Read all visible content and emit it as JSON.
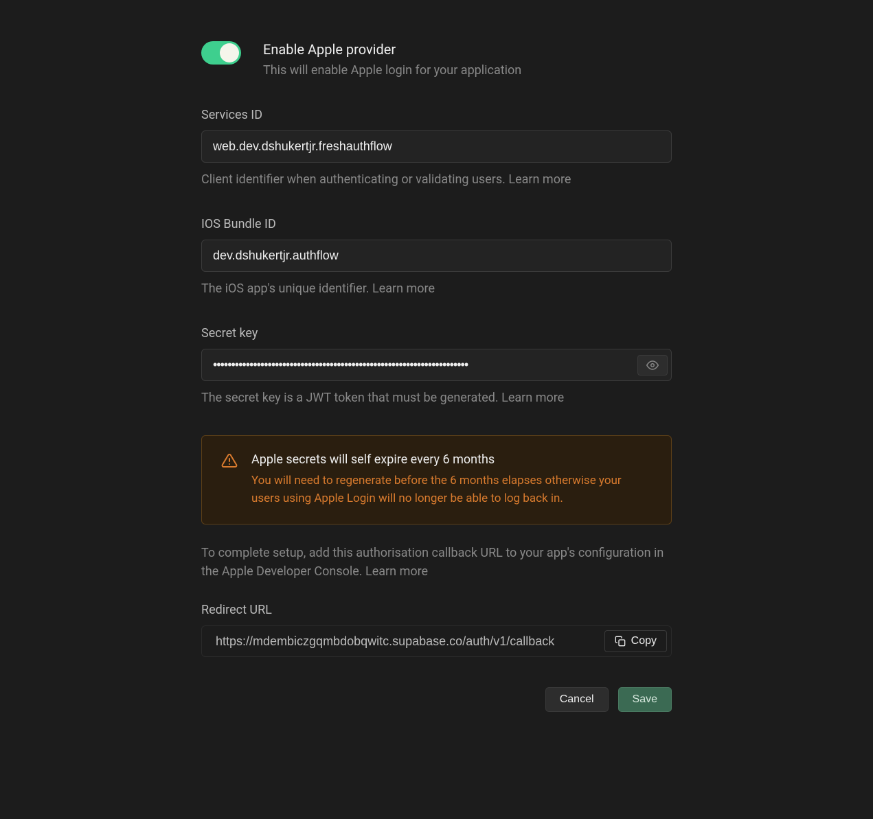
{
  "toggle": {
    "title": "Enable Apple provider",
    "subtitle": "This will enable Apple login for your application"
  },
  "servicesId": {
    "label": "Services ID",
    "value": "web.dev.dshukertjr.freshauthflow",
    "help": "Client identifier when authenticating or validating users. ",
    "learnMore": "Learn more"
  },
  "iosBundleId": {
    "label": "IOS Bundle ID",
    "value": "dev.dshukertjr.authflow",
    "help": "The iOS app's unique identifier. ",
    "learnMore": "Learn more"
  },
  "secretKey": {
    "label": "Secret key",
    "value": "••••••••••••••••••••••••••••••••••••••••••••••••••••••••••••••••••••••",
    "help": "The secret key is a JWT token that must be generated. ",
    "learnMore": "Learn more"
  },
  "warning": {
    "title": "Apple secrets will self expire every 6 months",
    "text": "You will need to regenerate before the 6 months elapses otherwise your users using Apple Login will no longer be able to log back in."
  },
  "callback": {
    "text": "To complete setup, add this authorisation callback URL to your app's configuration in the Apple Developer Console. ",
    "learnMore": "Learn more"
  },
  "redirectUrl": {
    "label": "Redirect URL",
    "value": "https://mdembiczgqmbdobqwitc.supabase.co/auth/v1/callback",
    "copyLabel": "Copy"
  },
  "buttons": {
    "cancel": "Cancel",
    "save": "Save"
  }
}
